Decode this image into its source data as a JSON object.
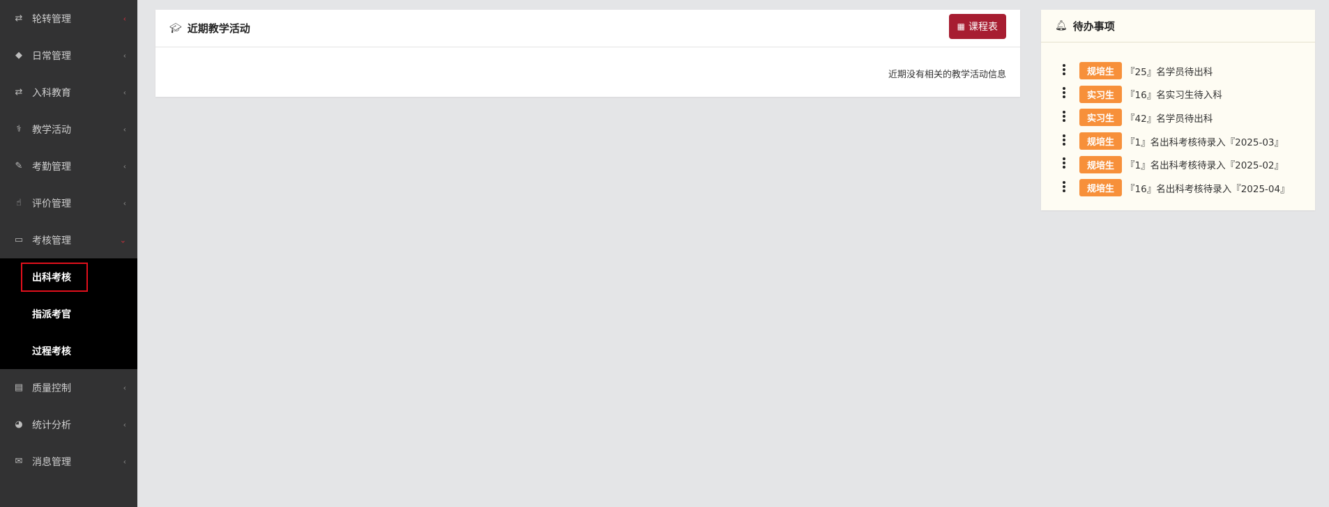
{
  "sidebar": {
    "items": [
      {
        "label": "轮转管理",
        "icon": "rotate-icon",
        "chevron": "red"
      },
      {
        "label": "日常管理",
        "icon": "tag-icon",
        "chevron": "grey"
      },
      {
        "label": "入科教育",
        "icon": "rotate-icon",
        "chevron": "grey"
      },
      {
        "label": "教学活动",
        "icon": "stethoscope-icon",
        "chevron": "grey"
      },
      {
        "label": "考勤管理",
        "icon": "brush-icon",
        "chevron": "grey"
      },
      {
        "label": "评价管理",
        "icon": "thumbs-up-icon",
        "chevron": "grey"
      },
      {
        "label": "考核管理",
        "icon": "desktop-icon",
        "chevron": "red-down"
      }
    ],
    "submenu": [
      {
        "label": "出科考核",
        "active": true
      },
      {
        "label": "指派考官",
        "active": false
      },
      {
        "label": "过程考核",
        "active": false
      }
    ],
    "items_after": [
      {
        "label": "质量控制",
        "icon": "newspaper-icon"
      },
      {
        "label": "统计分析",
        "icon": "pie-chart-icon"
      },
      {
        "label": "消息管理",
        "icon": "comments-icon"
      }
    ]
  },
  "activity": {
    "title": "近期教学活动",
    "icon": "graduation-cap-icon",
    "schedule_button": "课程表",
    "empty_message": "近期没有相关的教学活动信息"
  },
  "todo": {
    "title": "待办事项",
    "icon": "bell-icon",
    "items": [
      {
        "badge": "规培生",
        "text": "『25』名学员待出科"
      },
      {
        "badge": "实习生",
        "text": "『16』名实习生待入科"
      },
      {
        "badge": "实习生",
        "text": "『42』名学员待出科"
      },
      {
        "badge": "规培生",
        "text": "『1』名出科考核待录入『2025-03』"
      },
      {
        "badge": "规培生",
        "text": "『1』名出科考核待录入『2025-02』"
      },
      {
        "badge": "规培生",
        "text": "『16』名出科考核待录入『2025-04』"
      }
    ]
  },
  "colors": {
    "sidebar_bg": "#323233",
    "submenu_bg": "#000000",
    "accent_red": "#a71d31",
    "badge_orange": "#f7903a",
    "highlight_box": "#e3101c"
  }
}
